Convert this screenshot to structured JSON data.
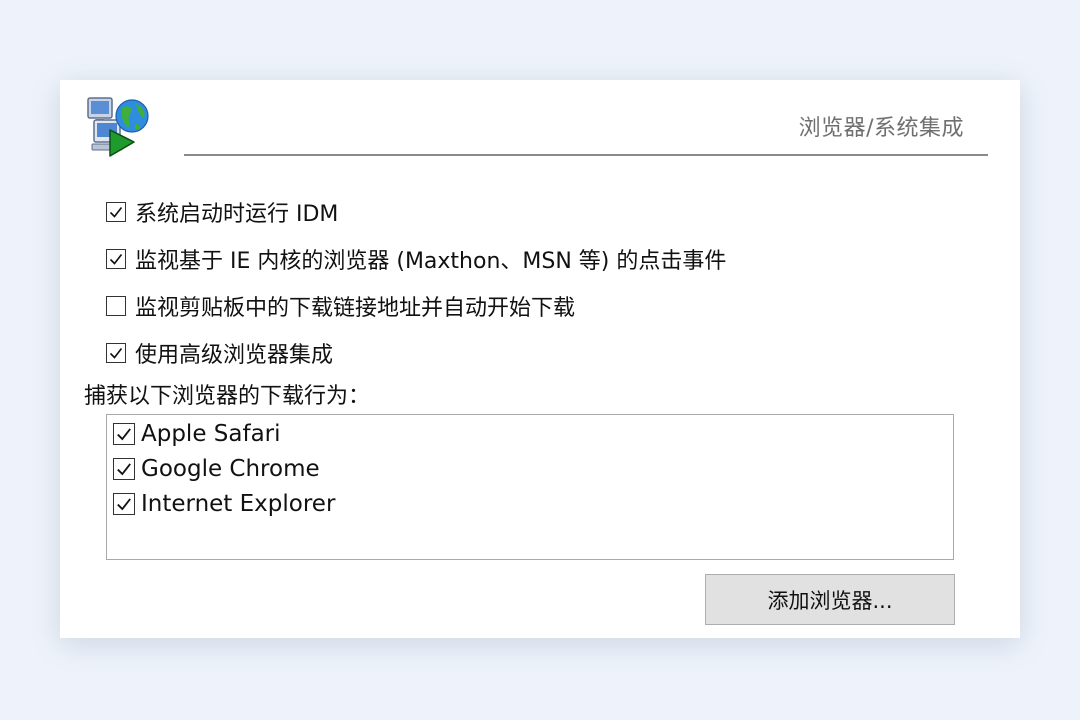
{
  "header": {
    "section_title": "浏览器/系统集成",
    "logo_icon": "idm-integration-icon"
  },
  "options": [
    {
      "label": "系统启动时运行 IDM",
      "checked": true
    },
    {
      "label": "监视基于 IE 内核的浏览器 (Maxthon、MSN 等) 的点击事件",
      "checked": true
    },
    {
      "label": "监视剪贴板中的下载链接地址并自动开始下载",
      "checked": false
    },
    {
      "label": "使用高级浏览器集成",
      "checked": true
    }
  ],
  "browser_group": {
    "label": "捕获以下浏览器的下载行为：",
    "browsers": [
      {
        "label": "Apple Safari",
        "checked": true
      },
      {
        "label": "Google Chrome",
        "checked": true
      },
      {
        "label": "Internet Explorer",
        "checked": true
      }
    ]
  },
  "buttons": {
    "add_browser": "添加浏览器..."
  },
  "colors": {
    "background": "#eef3fb",
    "panel": "#ffffff",
    "button_face": "#e1e1e1",
    "title_text": "#6f6f6f"
  }
}
